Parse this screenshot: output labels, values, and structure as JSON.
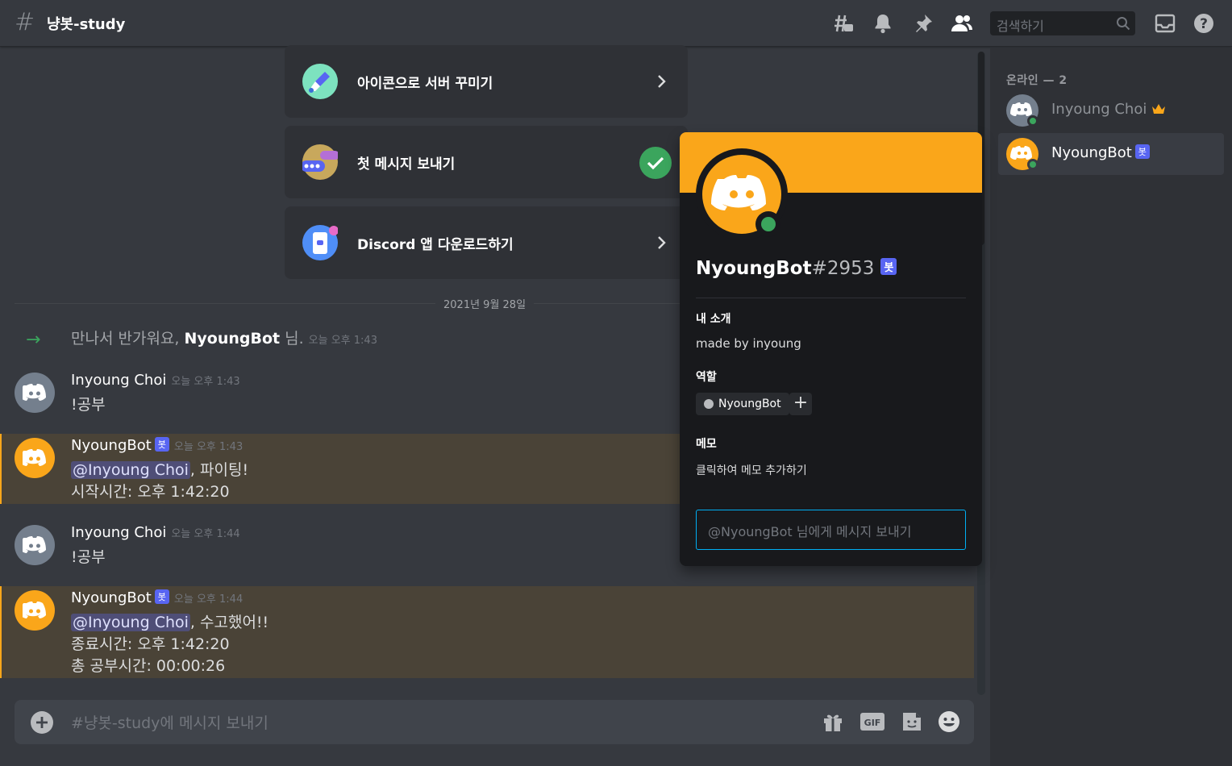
{
  "header": {
    "channel_name": "냥봇-study",
    "search_placeholder": "검색하기",
    "icons": [
      "threads-icon",
      "bell-icon",
      "pin-icon",
      "members-icon",
      "inbox-icon",
      "help-icon"
    ]
  },
  "onboarding": [
    {
      "label": "아이콘으로 서버 꾸미기",
      "done": false
    },
    {
      "label": "첫 메시지 보내기",
      "done": true
    },
    {
      "label": "Discord 앱 다운로드하기",
      "done": false
    }
  ],
  "date_divider": "2021년 9월 28일",
  "join_message": {
    "prefix": "만나서 반가워요, ",
    "user": "NyoungBot",
    "suffix": " 님.",
    "timestamp": "오늘 오후 1:43"
  },
  "messages": [
    {
      "author": "Inyoung Choi",
      "bot": false,
      "timestamp": "오늘 오후 1:43",
      "lines": [
        "!공부"
      ]
    },
    {
      "author": "NyoungBot",
      "bot": true,
      "bot_label": "봇",
      "timestamp": "오늘 오후 1:43",
      "mention": "@Inyoung Choi",
      "first_rest": ", 파이팅!",
      "lines": [
        " 시작시간: 오후 1:42:20"
      ]
    },
    {
      "author": "Inyoung Choi",
      "bot": false,
      "timestamp": "오늘 오후 1:44",
      "lines": [
        "!공부"
      ]
    },
    {
      "author": "NyoungBot",
      "bot": true,
      "bot_label": "봇",
      "timestamp": "오늘 오후 1:44",
      "mention": "@Inyoung Choi",
      "first_rest": ", 수고했어!!",
      "lines": [
        " 종료시간: 오후 1:42:20",
        " 총 공부시간: 00:00:26"
      ]
    }
  ],
  "composer": {
    "placeholder": "#냥봇-study에 메시지 보내기"
  },
  "members": {
    "header": "온라인 — 2",
    "list": [
      {
        "name": "Inyoung Choi",
        "owner": true,
        "selected": false
      },
      {
        "name": "NyoungBot",
        "bot_label": "봇",
        "selected": true
      }
    ]
  },
  "profile": {
    "username": "NyoungBot",
    "discriminator": "#2953",
    "bot_label": "봇",
    "about_heading": "내 소개",
    "about_text": "made by inyoung",
    "roles_heading": "역할",
    "role": "NyoungBot",
    "note_heading": "메모",
    "note_placeholder": "클릭하여 메모 추가하기",
    "message_placeholder": "@NyoungBot 님에게 메시지 보내기"
  },
  "colors": {
    "accent": "#5865f2",
    "bot_orange": "#faa61a",
    "online": "#3ba55d",
    "highlight": "#4a4337"
  }
}
